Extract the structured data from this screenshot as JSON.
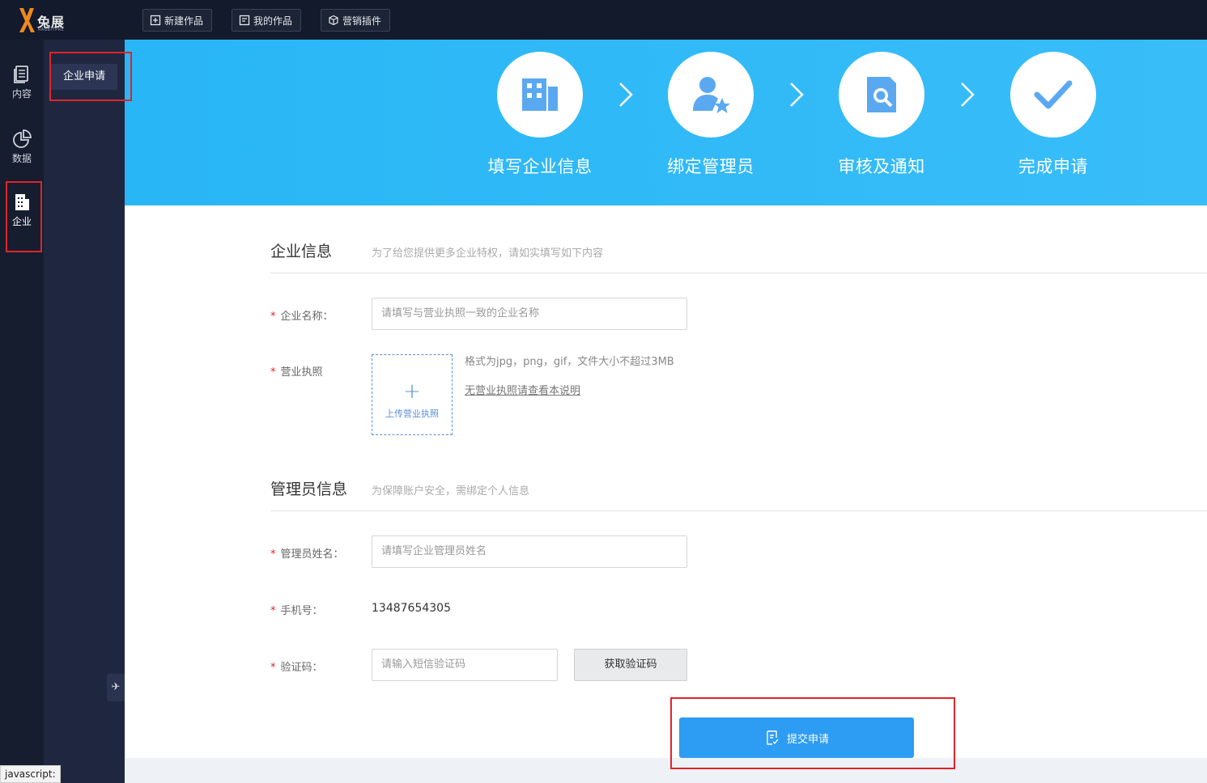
{
  "brand": {
    "name": "兔展",
    "sub": "RABBITPRE"
  },
  "topbar": {
    "new_work": "新建作品",
    "my_works": "我的作品",
    "marketing_plugins": "营销插件"
  },
  "leftnav": {
    "content": "内容",
    "data": "数据",
    "enterprise": "企业"
  },
  "subnav": {
    "item": "企业申请"
  },
  "steps": {
    "s1": "填写企业信息",
    "s2": "绑定管理员",
    "s3": "审核及通知",
    "s4": "完成申请"
  },
  "company": {
    "title": "企业信息",
    "hint": "为了给您提供更多企业特权，请如实填写如下内容",
    "name_label": "企业名称：",
    "name_placeholder": "请填写与营业执照一致的企业名称",
    "license_label": "营业执照",
    "upload_text": "上传营业执照",
    "upload_plus": "+",
    "upload_hint": "格式为jpg，png，gif，文件大小不超过3MB",
    "no_license_link": "无营业执照请查看本说明"
  },
  "admin": {
    "title": "管理员信息",
    "hint": "为保障账户安全，需绑定个人信息",
    "name_label": "管理员姓名：",
    "name_placeholder": "请填写企业管理员姓名",
    "phone_label": "手机号：",
    "phone_value": "13487654305",
    "code_label": "验证码：",
    "code_placeholder": "请输入短信验证码",
    "get_code": "获取验证码"
  },
  "submit_label": "提交申请",
  "required_mark": "*",
  "status_text": "javascript:",
  "colors": {
    "accent": "#2d9cf3",
    "hero": "#38bdf8",
    "highlight": "#e0242a"
  }
}
